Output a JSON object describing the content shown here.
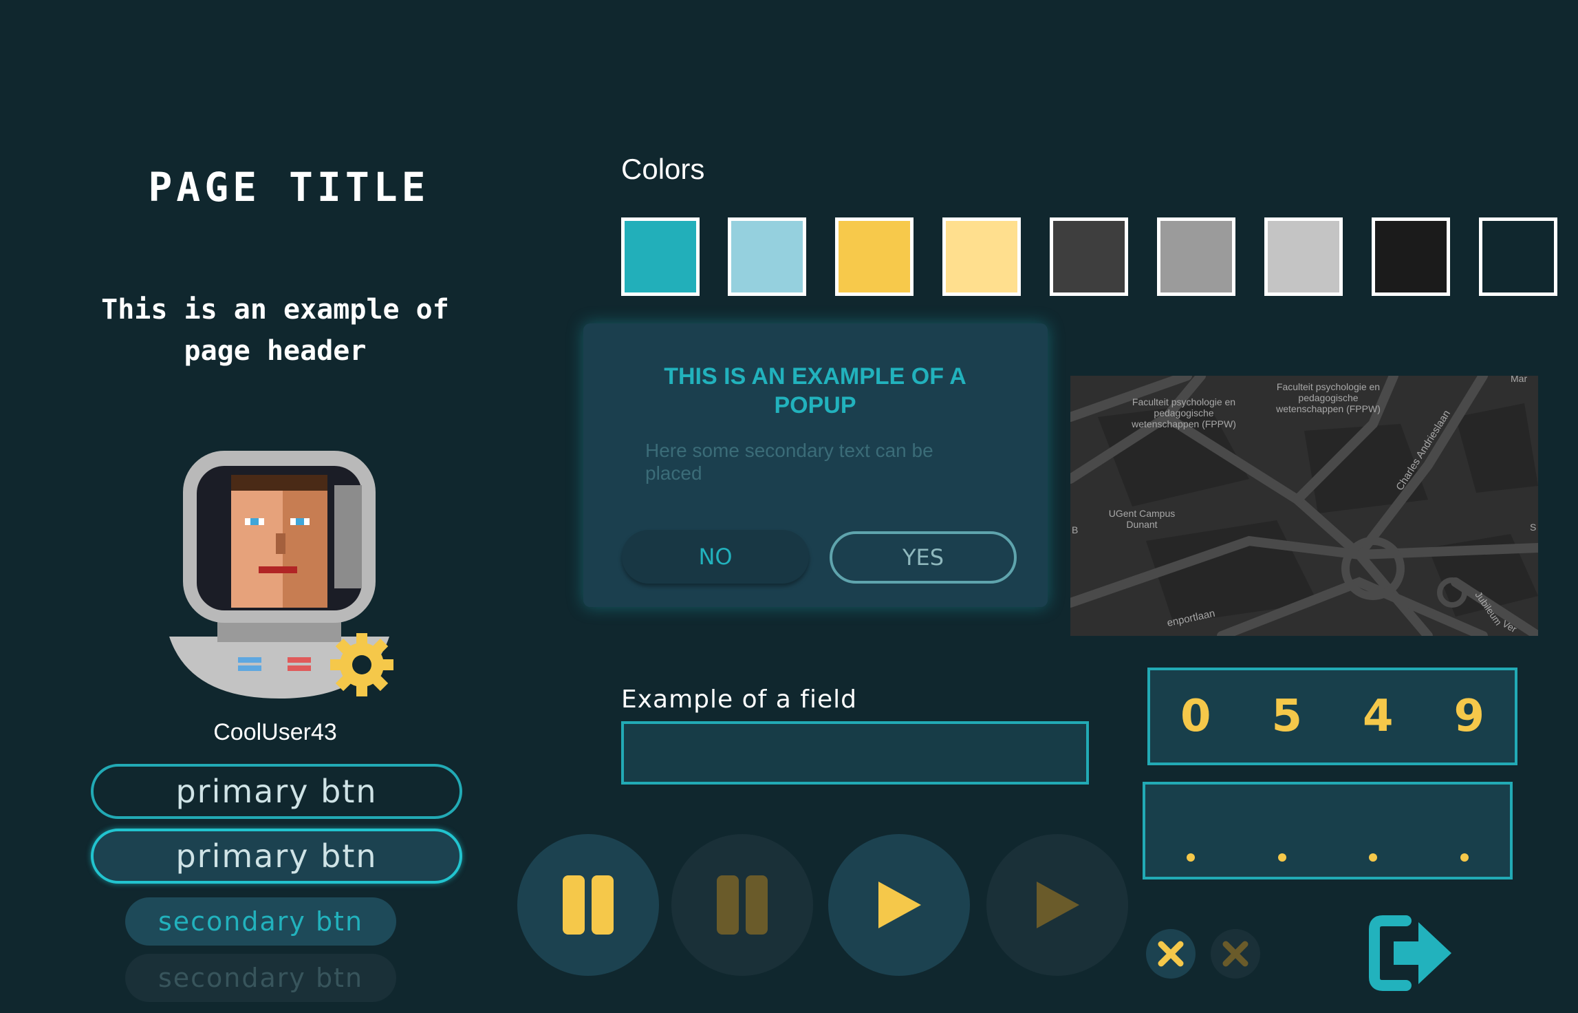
{
  "left": {
    "page_title": "PAGE TITLE",
    "page_header": "This is an example of page header",
    "username": "CoolUser43",
    "buttons": {
      "primary_outline": "primary btn",
      "primary_filled": "primary btn",
      "secondary": "secondary btn",
      "secondary_disabled": "secondary btn"
    }
  },
  "colors": {
    "title": "Colors",
    "swatches": [
      "#22afba",
      "#95d0de",
      "#f7c94b",
      "#ffdf8e",
      "#3e3e3e",
      "#9b9b9b",
      "#c4c4c4",
      "#1b1b1b",
      "#10272e"
    ]
  },
  "popup": {
    "title": "THIS IS AN EXAMPLE OF A POPUP",
    "text": "Here some secondary text can be placed",
    "no_label": "NO",
    "yes_label": "YES"
  },
  "map": {
    "labels": [
      "Faculteit psychologie en pedagogische wetenschappen (FPPW)",
      "Faculteit psychologie en pedagogische wetenschappen (FPPW)",
      "UGent Campus Dunant",
      "Charles Andrieslaan",
      "Jubileum",
      "Mar",
      "B",
      "S",
      "Ver",
      "enportlaan"
    ]
  },
  "field": {
    "label": "Example of a field",
    "value": "",
    "placeholder": ""
  },
  "code": {
    "digits": [
      "0",
      "5",
      "4",
      "9"
    ]
  },
  "pin": {
    "filled": 4
  },
  "media": {
    "icons": [
      "pause-icon",
      "pause-icon-disabled",
      "play-icon",
      "play-icon-disabled"
    ]
  },
  "accent_colors": {
    "teal": "#22aab5",
    "yellow": "#f5c84a",
    "background": "#10272e"
  }
}
